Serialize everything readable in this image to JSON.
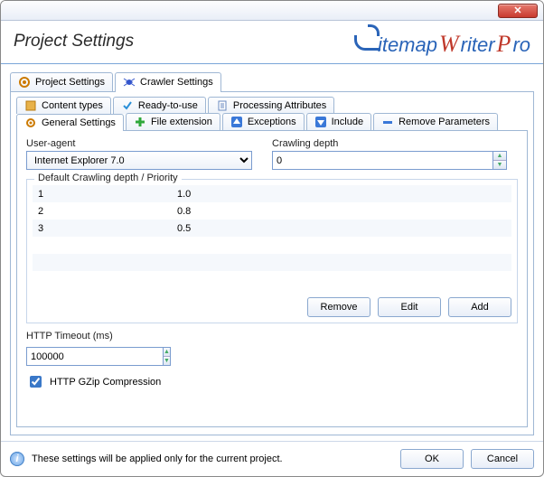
{
  "window": {
    "title": "Project Settings"
  },
  "logo": {
    "t1": "itemap",
    "t2": "W",
    "t3": "riter",
    "t4": "P",
    "t5": "ro"
  },
  "mainTabs": [
    {
      "label": "Project Settings",
      "icon": "gear-icon"
    },
    {
      "label": "Crawler Settings",
      "icon": "spider-icon"
    }
  ],
  "subTabsTop": [
    {
      "label": "Content types",
      "icon": "content-icon"
    },
    {
      "label": "Ready-to-use",
      "icon": "check-icon"
    },
    {
      "label": "Processing Attributes",
      "icon": "doc-icon"
    }
  ],
  "subTabsBottom": [
    {
      "label": "General Settings",
      "icon": "gear-icon"
    },
    {
      "label": "File extension",
      "icon": "plus-icon"
    },
    {
      "label": "Exceptions",
      "icon": "up-icon"
    },
    {
      "label": "Include",
      "icon": "down-icon"
    },
    {
      "label": "Remove Parameters",
      "icon": "minus-icon"
    }
  ],
  "general": {
    "userAgentLabel": "User-agent",
    "userAgentValue": "Internet Explorer 7.0",
    "crawlDepthLabel": "Crawling depth",
    "crawlDepthValue": "0",
    "groupLegend": "Default Crawling depth / Priority",
    "rows": [
      {
        "depth": "1",
        "priority": "1.0"
      },
      {
        "depth": "2",
        "priority": "0.8"
      },
      {
        "depth": "3",
        "priority": "0.5"
      }
    ],
    "buttons": {
      "remove": "Remove",
      "edit": "Edit",
      "add": "Add"
    },
    "httpTimeoutLabel": "HTTP Timeout (ms)",
    "httpTimeoutValue": "100000",
    "gzipLabel": "HTTP GZip Compression",
    "gzipChecked": true
  },
  "footer": {
    "info": "These settings will be applied only for the current project.",
    "ok": "OK",
    "cancel": "Cancel"
  }
}
